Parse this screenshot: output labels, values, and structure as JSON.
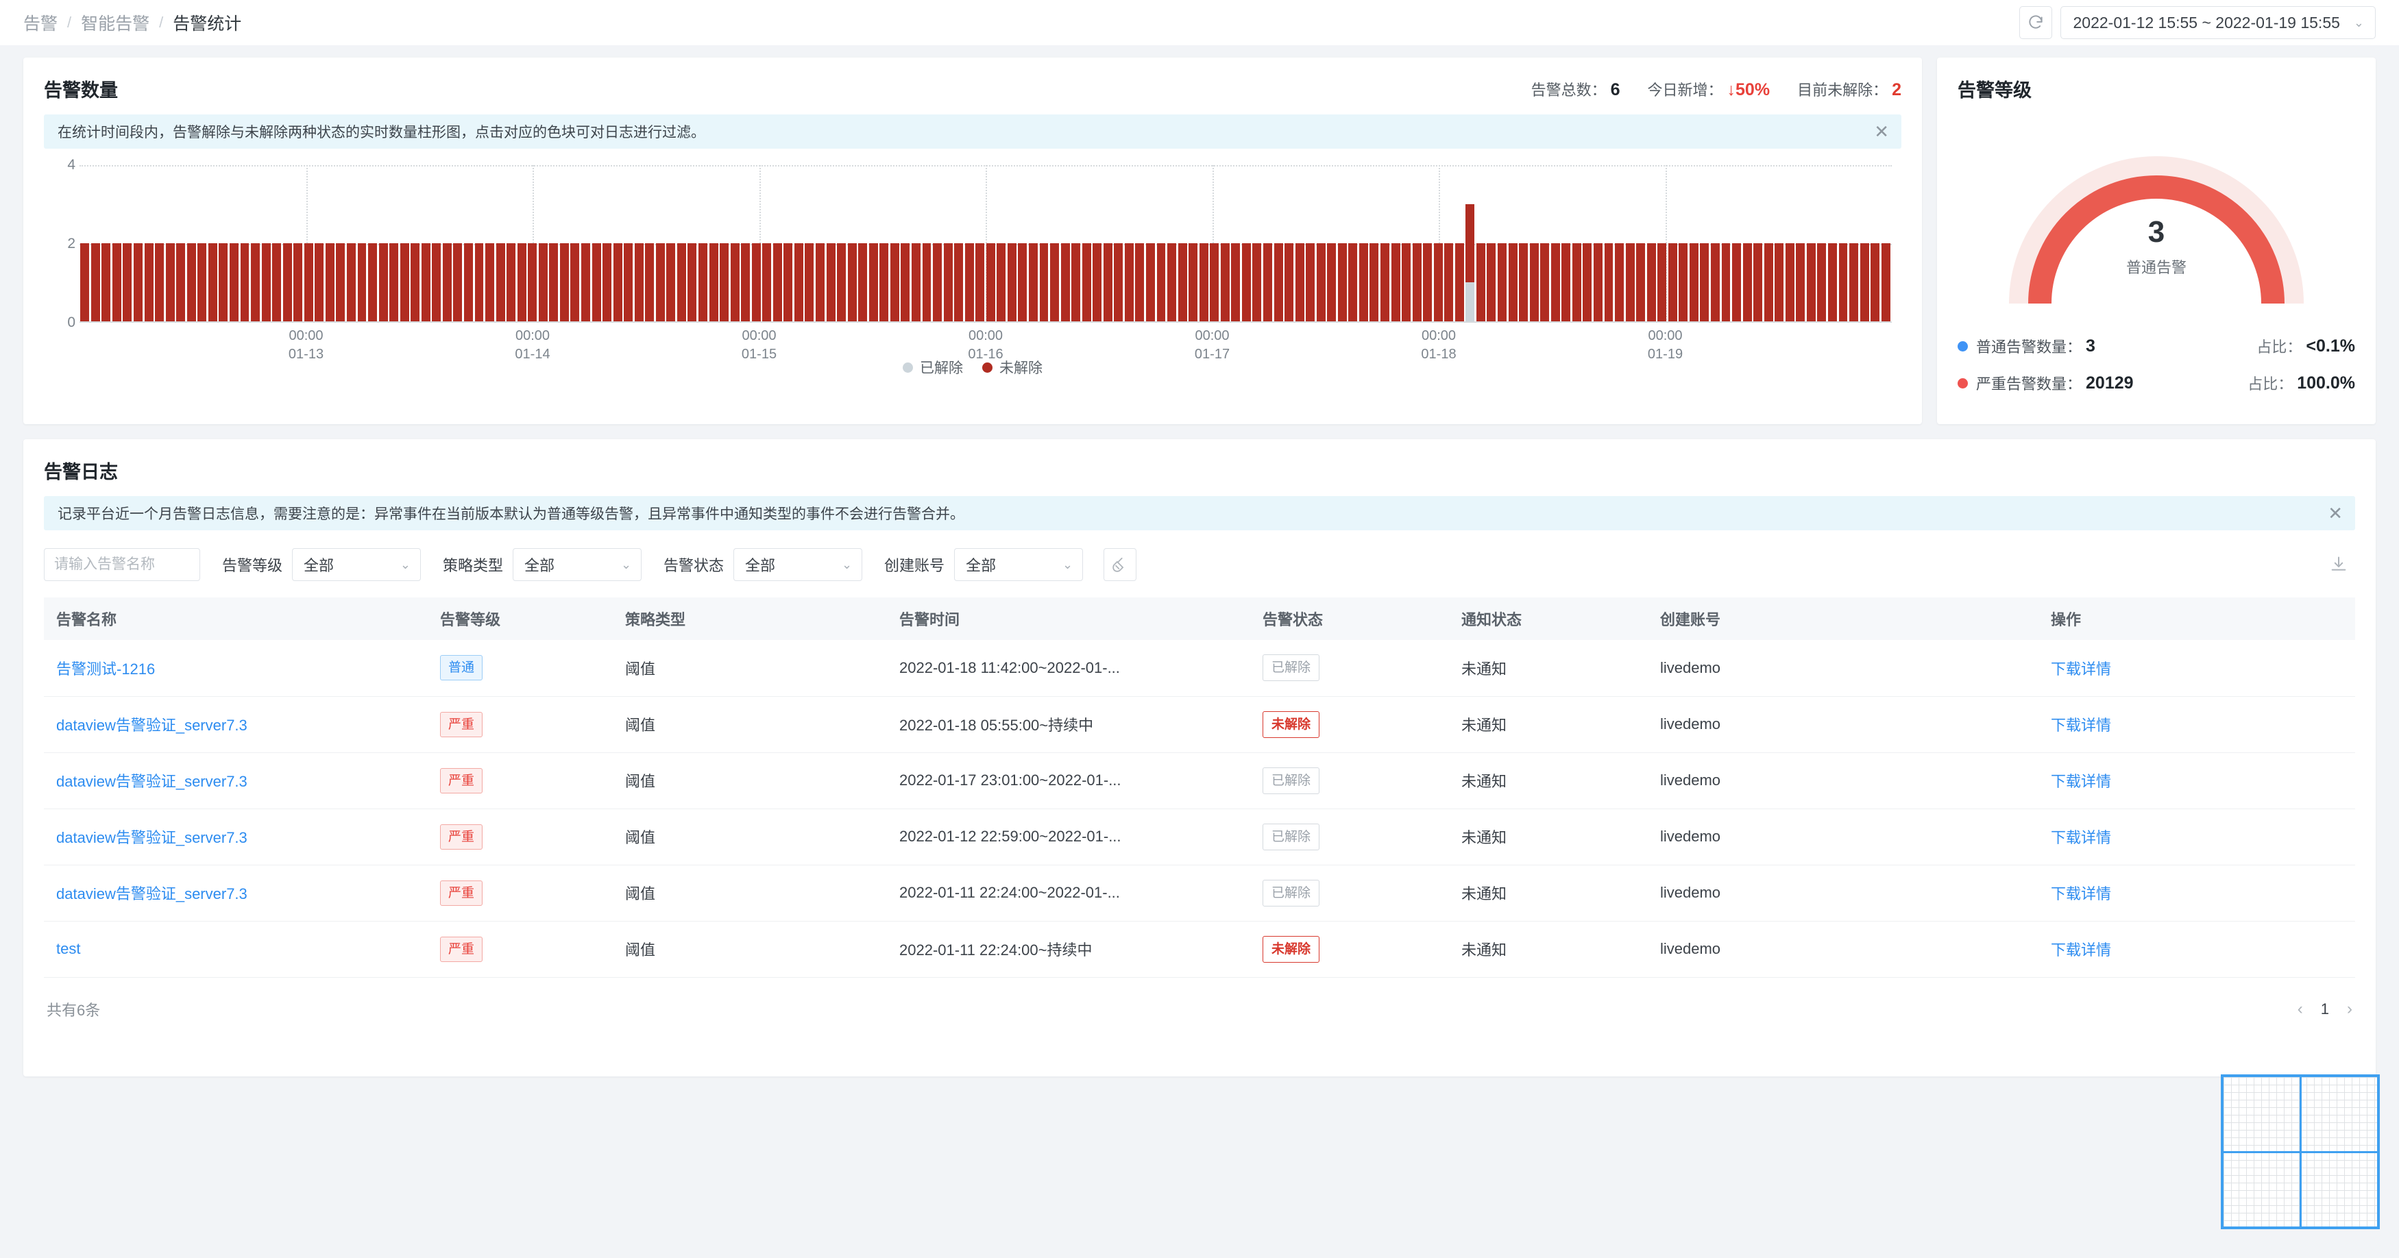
{
  "breadcrumb": {
    "items": [
      "告警",
      "智能告警",
      "告警统计"
    ],
    "separator": "/"
  },
  "toolbar": {
    "refresh_icon": "refresh-icon",
    "date_range": "2022-01-12 15:55 ~ 2022-01-19 15:55",
    "chevron": "⌄"
  },
  "alarm_count_card": {
    "title": "告警数量",
    "stats": {
      "total_label": "告警总数：",
      "total_value": "6",
      "today_label": "今日新增：",
      "today_value": "↓50%",
      "unresolved_label": "目前未解除：",
      "unresolved_value": "2"
    },
    "notice": "在统计时间段内，告警解除与未解除两种状态的实时数量柱形图，点击对应的色块可对日志进行过滤。",
    "notice_close": "✕",
    "legend": [
      {
        "label": "已解除",
        "color": "#ccd5db"
      },
      {
        "label": "未解除",
        "color": "#b02c21"
      }
    ]
  },
  "chart_data": {
    "type": "bar",
    "title": "告警数量",
    "stacked": true,
    "xlabel": "",
    "ylabel": "",
    "ylim": [
      0,
      4
    ],
    "yticks": [
      "0",
      "2",
      "4"
    ],
    "grid": true,
    "legend_position": "bottom",
    "categories": [
      "00:00 01-13",
      "00:00 01-14",
      "00:00 01-15",
      "00:00 01-16",
      "00:00 01-17",
      "00:00 01-18",
      "00:00 01-19"
    ],
    "xtick_labels": [
      {
        "time": "00:00",
        "date": "01-13"
      },
      {
        "time": "00:00",
        "date": "01-14"
      },
      {
        "time": "00:00",
        "date": "01-15"
      },
      {
        "time": "00:00",
        "date": "01-16"
      },
      {
        "time": "00:00",
        "date": "01-17"
      },
      {
        "time": "00:00",
        "date": "01-18"
      },
      {
        "time": "00:00",
        "date": "01-19"
      }
    ],
    "series": [
      {
        "name": "已解除",
        "color": "#ccd5db",
        "values": [
          0,
          0,
          0,
          0,
          0,
          0,
          0,
          0,
          0,
          0,
          0,
          0,
          0,
          0,
          0,
          0,
          0,
          0,
          0,
          0,
          0,
          0,
          0,
          0,
          0,
          0,
          0,
          0,
          0,
          0,
          0,
          0,
          0,
          0,
          0,
          0,
          0,
          0,
          0,
          0,
          0,
          0,
          0,
          0,
          0,
          0,
          0,
          0,
          0,
          0,
          0,
          0,
          0,
          0,
          0,
          0,
          0,
          0,
          0,
          0,
          0,
          0,
          0,
          0,
          0,
          0,
          0,
          0,
          0,
          0,
          0,
          0,
          0,
          0,
          0,
          0,
          0,
          0,
          0,
          0,
          0,
          0,
          0,
          0,
          0,
          0,
          0,
          0,
          0,
          0,
          0,
          0,
          0,
          0,
          0,
          0,
          0,
          0,
          0,
          0,
          0,
          0,
          0,
          0,
          0,
          0,
          0,
          0,
          0,
          0,
          0,
          0,
          0,
          0,
          0,
          0,
          0,
          0,
          0,
          0,
          0,
          0,
          0,
          0,
          0,
          0,
          0,
          0,
          0,
          0,
          1,
          0,
          0,
          0,
          0,
          0,
          0,
          0,
          0,
          0,
          0,
          0,
          0,
          0,
          0,
          0,
          0,
          0,
          0,
          0,
          0,
          0,
          0,
          0,
          0,
          0,
          0,
          0,
          0,
          0,
          0,
          0,
          0,
          0,
          0,
          0,
          0,
          0,
          0,
          0
        ]
      },
      {
        "name": "未解除",
        "color": "#b02c21",
        "values": [
          2,
          2,
          2,
          2,
          2,
          2,
          2,
          2,
          2,
          2,
          2,
          2,
          2,
          2,
          2,
          2,
          2,
          2,
          2,
          2,
          2,
          2,
          2,
          2,
          2,
          2,
          2,
          2,
          2,
          2,
          2,
          2,
          2,
          2,
          2,
          2,
          2,
          2,
          2,
          2,
          2,
          2,
          2,
          2,
          2,
          2,
          2,
          2,
          2,
          2,
          2,
          2,
          2,
          2,
          2,
          2,
          2,
          2,
          2,
          2,
          2,
          2,
          2,
          2,
          2,
          2,
          2,
          2,
          2,
          2,
          2,
          2,
          2,
          2,
          2,
          2,
          2,
          2,
          2,
          2,
          2,
          2,
          2,
          2,
          2,
          2,
          2,
          2,
          2,
          2,
          2,
          2,
          2,
          2,
          2,
          2,
          2,
          2,
          2,
          2,
          2,
          2,
          2,
          2,
          2,
          2,
          2,
          2,
          2,
          2,
          2,
          2,
          2,
          2,
          2,
          2,
          2,
          2,
          2,
          2,
          2,
          2,
          2,
          2,
          2,
          2,
          2,
          2,
          2,
          2,
          2,
          2,
          2,
          2,
          2,
          2,
          2,
          2,
          2,
          2,
          2,
          2,
          2,
          2,
          2,
          2,
          2,
          2,
          2,
          2,
          2,
          2,
          2,
          2,
          2,
          2,
          2,
          2,
          2,
          2,
          2,
          2,
          2,
          2,
          2,
          2,
          2,
          2,
          2,
          2
        ]
      }
    ]
  },
  "level_card": {
    "title": "告警等级",
    "gauge": {
      "value": "3",
      "label": "普通告警",
      "arc_color": "#ea5b50",
      "track_color": "#fae9e7"
    },
    "rows": [
      {
        "dot_color": "#3f93f5",
        "name": "普通告警数量：",
        "value": "3",
        "pct_label": "占比：",
        "pct": "<0.1%"
      },
      {
        "dot_color": "#ef5350",
        "name": "严重告警数量：",
        "value": "20129",
        "pct_label": "占比：",
        "pct": "100.0%"
      }
    ]
  },
  "log_card": {
    "title": "告警日志",
    "notice": "记录平台近一个月告警日志信息，需要注意的是：异常事件在当前版本默认为普通等级告警，且异常事件中通知类型的事件不会进行告警合并。",
    "notice_close": "✕",
    "filters": {
      "search_placeholder": "请输入告警名称",
      "search_value": "",
      "search_icon": "search-icon",
      "level": {
        "label": "告警等级",
        "value": "全部"
      },
      "policy": {
        "label": "策略类型",
        "value": "全部"
      },
      "status": {
        "label": "告警状态",
        "value": "全部"
      },
      "account": {
        "label": "创建账号",
        "value": "全部"
      },
      "reset_icon": "broom-icon",
      "download_icon": "download-icon"
    },
    "table": {
      "columns": [
        "告警名称",
        "告警等级",
        "策略类型",
        "告警时间",
        "告警状态",
        "通知状态",
        "创建账号",
        "操作"
      ],
      "rows": [
        {
          "name": "告警测试-1216",
          "level": "普通",
          "level_type": "normal",
          "policy": "阈值",
          "time": "2022-01-18 11:42:00~2022-01-...",
          "status": "已解除",
          "status_type": "resolved",
          "notify": "未通知",
          "account": "livedemo",
          "action": "下载详情"
        },
        {
          "name": "dataview告警验证_server7.3",
          "level": "严重",
          "level_type": "severe",
          "policy": "阈值",
          "time": "2022-01-18 05:55:00~持续中",
          "status": "未解除",
          "status_type": "unresolved",
          "notify": "未通知",
          "account": "livedemo",
          "action": "下载详情"
        },
        {
          "name": "dataview告警验证_server7.3",
          "level": "严重",
          "level_type": "severe",
          "policy": "阈值",
          "time": "2022-01-17 23:01:00~2022-01-...",
          "status": "已解除",
          "status_type": "resolved",
          "notify": "未通知",
          "account": "livedemo",
          "action": "下载详情"
        },
        {
          "name": "dataview告警验证_server7.3",
          "level": "严重",
          "level_type": "severe",
          "policy": "阈值",
          "time": "2022-01-12 22:59:00~2022-01-...",
          "status": "已解除",
          "status_type": "resolved",
          "notify": "未通知",
          "account": "livedemo",
          "action": "下载详情"
        },
        {
          "name": "dataview告警验证_server7.3",
          "level": "严重",
          "level_type": "severe",
          "policy": "阈值",
          "time": "2022-01-11 22:24:00~2022-01-...",
          "status": "已解除",
          "status_type": "resolved",
          "notify": "未通知",
          "account": "livedemo",
          "action": "下载详情"
        },
        {
          "name": "test",
          "level": "严重",
          "level_type": "severe",
          "policy": "阈值",
          "time": "2022-01-11 22:24:00~持续中",
          "status": "未解除",
          "status_type": "unresolved",
          "notify": "未通知",
          "account": "livedemo",
          "action": "下载详情"
        }
      ]
    },
    "footer": {
      "total": "共有6条",
      "prev": "‹",
      "page": "1",
      "next": "›"
    }
  }
}
